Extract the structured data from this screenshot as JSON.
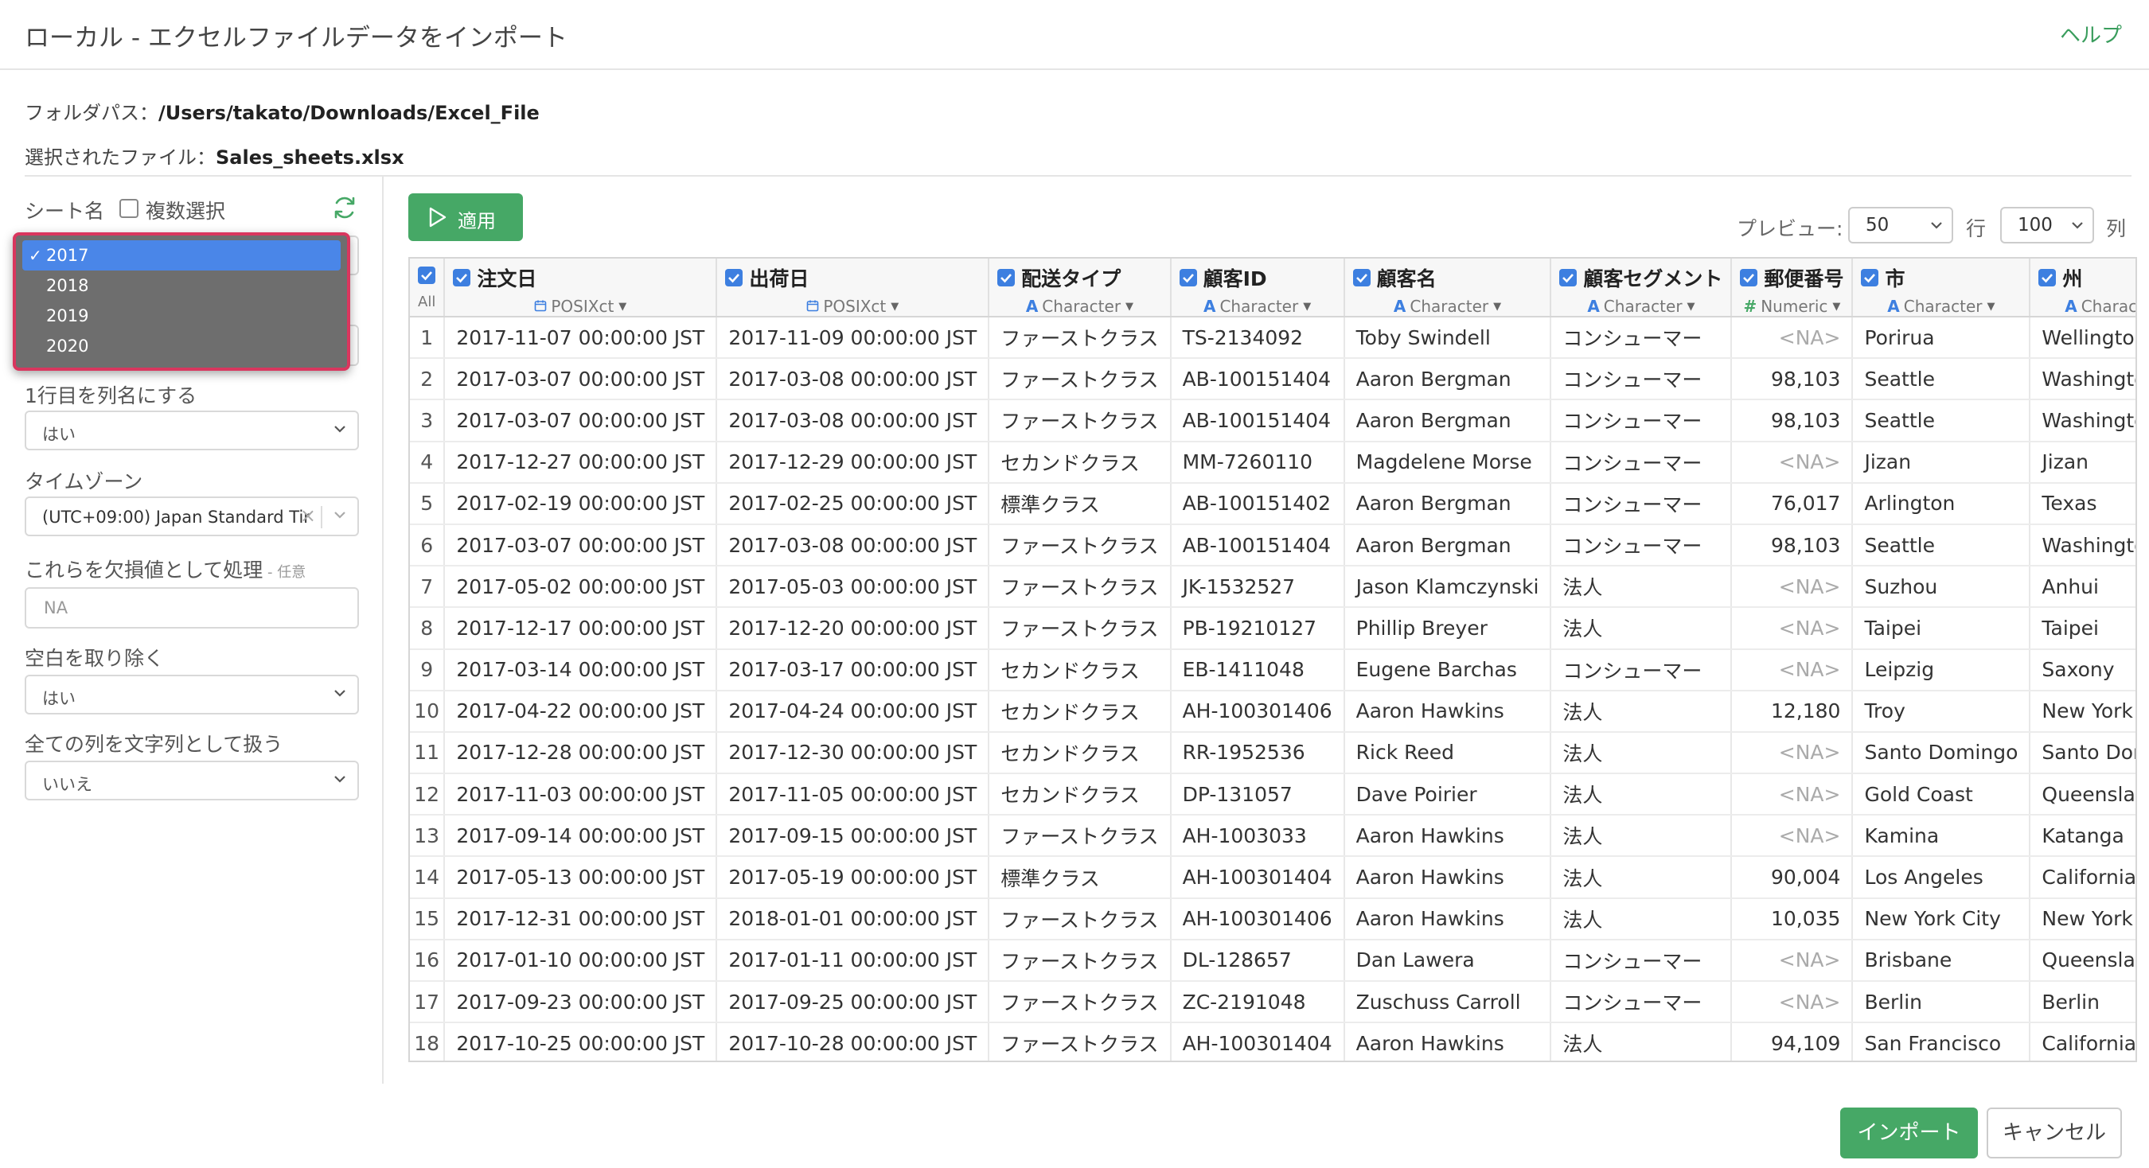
{
  "header": {
    "title": "ローカル - エクセルファイルデータをインポート",
    "help_label": "ヘルプ"
  },
  "info": {
    "folder_label": "フォルダパス：",
    "folder_path": "/Users/takato/Downloads/Excel_File",
    "file_label": "選択されたファイル：",
    "file_name": "Sales_sheets.xlsx"
  },
  "left_panel": {
    "sheet_name_label": "シート名",
    "multi_select_label": "複数選択",
    "sheet_options": [
      "2017",
      "2018",
      "2019",
      "2020"
    ],
    "selected_sheet": "2017",
    "header_row_label": "1行目を列名にする",
    "header_row_value": "はい",
    "timezone_label": "タイムゾーン",
    "timezone_value": "(UTC+09:00) Japan Standard Tir",
    "na_label": "これらを欠損値として処理",
    "na_optional": " - 任意",
    "na_placeholder": "NA",
    "trim_label": "空白を取り除く",
    "trim_value": "はい",
    "all_string_label": "全ての列を文字列として扱う",
    "all_string_value": "いいえ"
  },
  "toolbar": {
    "apply_label": "適用",
    "preview_label": "プレビュー:",
    "rows_value": "50",
    "rows_unit": "行",
    "cols_value": "100",
    "cols_unit": "列"
  },
  "table": {
    "all_label": "All",
    "columns": [
      {
        "name": "注文日",
        "type": "POSIXct",
        "icon": "calendar-icon"
      },
      {
        "name": "出荷日",
        "type": "POSIXct",
        "icon": "calendar-icon"
      },
      {
        "name": "配送タイプ",
        "type": "Character",
        "icon": "character-type-icon"
      },
      {
        "name": "顧客ID",
        "type": "Character",
        "icon": "character-type-icon"
      },
      {
        "name": "顧客名",
        "type": "Character",
        "icon": "character-type-icon"
      },
      {
        "name": "顧客セグメント",
        "type": "Character",
        "icon": "character-type-icon"
      },
      {
        "name": "郵便番号",
        "type": "Numeric",
        "icon": "numeric-type-icon"
      },
      {
        "name": "市",
        "type": "Character",
        "icon": "character-type-icon"
      },
      {
        "name": "州",
        "type": "Character",
        "icon": "character-type-icon"
      }
    ],
    "rows": [
      [
        "1",
        "2017-11-07 00:00:00 JST",
        "2017-11-09 00:00:00 JST",
        "ファーストクラス",
        "TS-2134092",
        "Toby Swindell",
        "コンシューマー",
        "<NA>",
        "Porirua",
        "Wellington"
      ],
      [
        "2",
        "2017-03-07 00:00:00 JST",
        "2017-03-08 00:00:00 JST",
        "ファーストクラス",
        "AB-100151404",
        "Aaron Bergman",
        "コンシューマー",
        "98,103",
        "Seattle",
        "Washington"
      ],
      [
        "3",
        "2017-03-07 00:00:00 JST",
        "2017-03-08 00:00:00 JST",
        "ファーストクラス",
        "AB-100151404",
        "Aaron Bergman",
        "コンシューマー",
        "98,103",
        "Seattle",
        "Washington"
      ],
      [
        "4",
        "2017-12-27 00:00:00 JST",
        "2017-12-29 00:00:00 JST",
        "セカンドクラス",
        "MM-7260110",
        "Magdelene Morse",
        "コンシューマー",
        "<NA>",
        "Jizan",
        "Jizan"
      ],
      [
        "5",
        "2017-02-19 00:00:00 JST",
        "2017-02-25 00:00:00 JST",
        "標準クラス",
        "AB-100151402",
        "Aaron Bergman",
        "コンシューマー",
        "76,017",
        "Arlington",
        "Texas"
      ],
      [
        "6",
        "2017-03-07 00:00:00 JST",
        "2017-03-08 00:00:00 JST",
        "ファーストクラス",
        "AB-100151404",
        "Aaron Bergman",
        "コンシューマー",
        "98,103",
        "Seattle",
        "Washington"
      ],
      [
        "7",
        "2017-05-02 00:00:00 JST",
        "2017-05-03 00:00:00 JST",
        "ファーストクラス",
        "JK-1532527",
        "Jason Klamczynski",
        "法人",
        "<NA>",
        "Suzhou",
        "Anhui"
      ],
      [
        "8",
        "2017-12-17 00:00:00 JST",
        "2017-12-20 00:00:00 JST",
        "ファーストクラス",
        "PB-19210127",
        "Phillip Breyer",
        "法人",
        "<NA>",
        "Taipei",
        "Taipei"
      ],
      [
        "9",
        "2017-03-14 00:00:00 JST",
        "2017-03-17 00:00:00 JST",
        "セカンドクラス",
        "EB-1411048",
        "Eugene Barchas",
        "コンシューマー",
        "<NA>",
        "Leipzig",
        "Saxony"
      ],
      [
        "10",
        "2017-04-22 00:00:00 JST",
        "2017-04-24 00:00:00 JST",
        "セカンドクラス",
        "AH-100301406",
        "Aaron Hawkins",
        "法人",
        "12,180",
        "Troy",
        "New York"
      ],
      [
        "11",
        "2017-12-28 00:00:00 JST",
        "2017-12-30 00:00:00 JST",
        "セカンドクラス",
        "RR-1952536",
        "Rick Reed",
        "法人",
        "<NA>",
        "Santo Domingo",
        "Santo Domingo"
      ],
      [
        "12",
        "2017-11-03 00:00:00 JST",
        "2017-11-05 00:00:00 JST",
        "セカンドクラス",
        "DP-131057",
        "Dave Poirier",
        "法人",
        "<NA>",
        "Gold Coast",
        "Queensland"
      ],
      [
        "13",
        "2017-09-14 00:00:00 JST",
        "2017-09-15 00:00:00 JST",
        "ファーストクラス",
        "AH-1003033",
        "Aaron Hawkins",
        "法人",
        "<NA>",
        "Kamina",
        "Katanga"
      ],
      [
        "14",
        "2017-05-13 00:00:00 JST",
        "2017-05-19 00:00:00 JST",
        "標準クラス",
        "AH-100301404",
        "Aaron Hawkins",
        "法人",
        "90,004",
        "Los Angeles",
        "California"
      ],
      [
        "15",
        "2017-12-31 00:00:00 JST",
        "2018-01-01 00:00:00 JST",
        "ファーストクラス",
        "AH-100301406",
        "Aaron Hawkins",
        "法人",
        "10,035",
        "New York City",
        "New York"
      ],
      [
        "16",
        "2017-01-10 00:00:00 JST",
        "2017-01-11 00:00:00 JST",
        "ファーストクラス",
        "DL-128657",
        "Dan Lawera",
        "コンシューマー",
        "<NA>",
        "Brisbane",
        "Queensland"
      ],
      [
        "17",
        "2017-09-23 00:00:00 JST",
        "2017-09-25 00:00:00 JST",
        "ファーストクラス",
        "ZC-2191048",
        "Zuschuss Carroll",
        "コンシューマー",
        "<NA>",
        "Berlin",
        "Berlin"
      ],
      [
        "18",
        "2017-10-25 00:00:00 JST",
        "2017-10-28 00:00:00 JST",
        "ファーストクラス",
        "AH-100301404",
        "Aaron Hawkins",
        "法人",
        "94,109",
        "San Francisco",
        "California"
      ]
    ]
  },
  "footer": {
    "import_label": "インポート",
    "cancel_label": "キャンセル"
  },
  "colors": {
    "accent_green": "#46a866",
    "checkbox_blue": "#3d7fe0",
    "dropdown_selected": "#4a86e8",
    "dropdown_highlight_border": "#d9365e"
  }
}
